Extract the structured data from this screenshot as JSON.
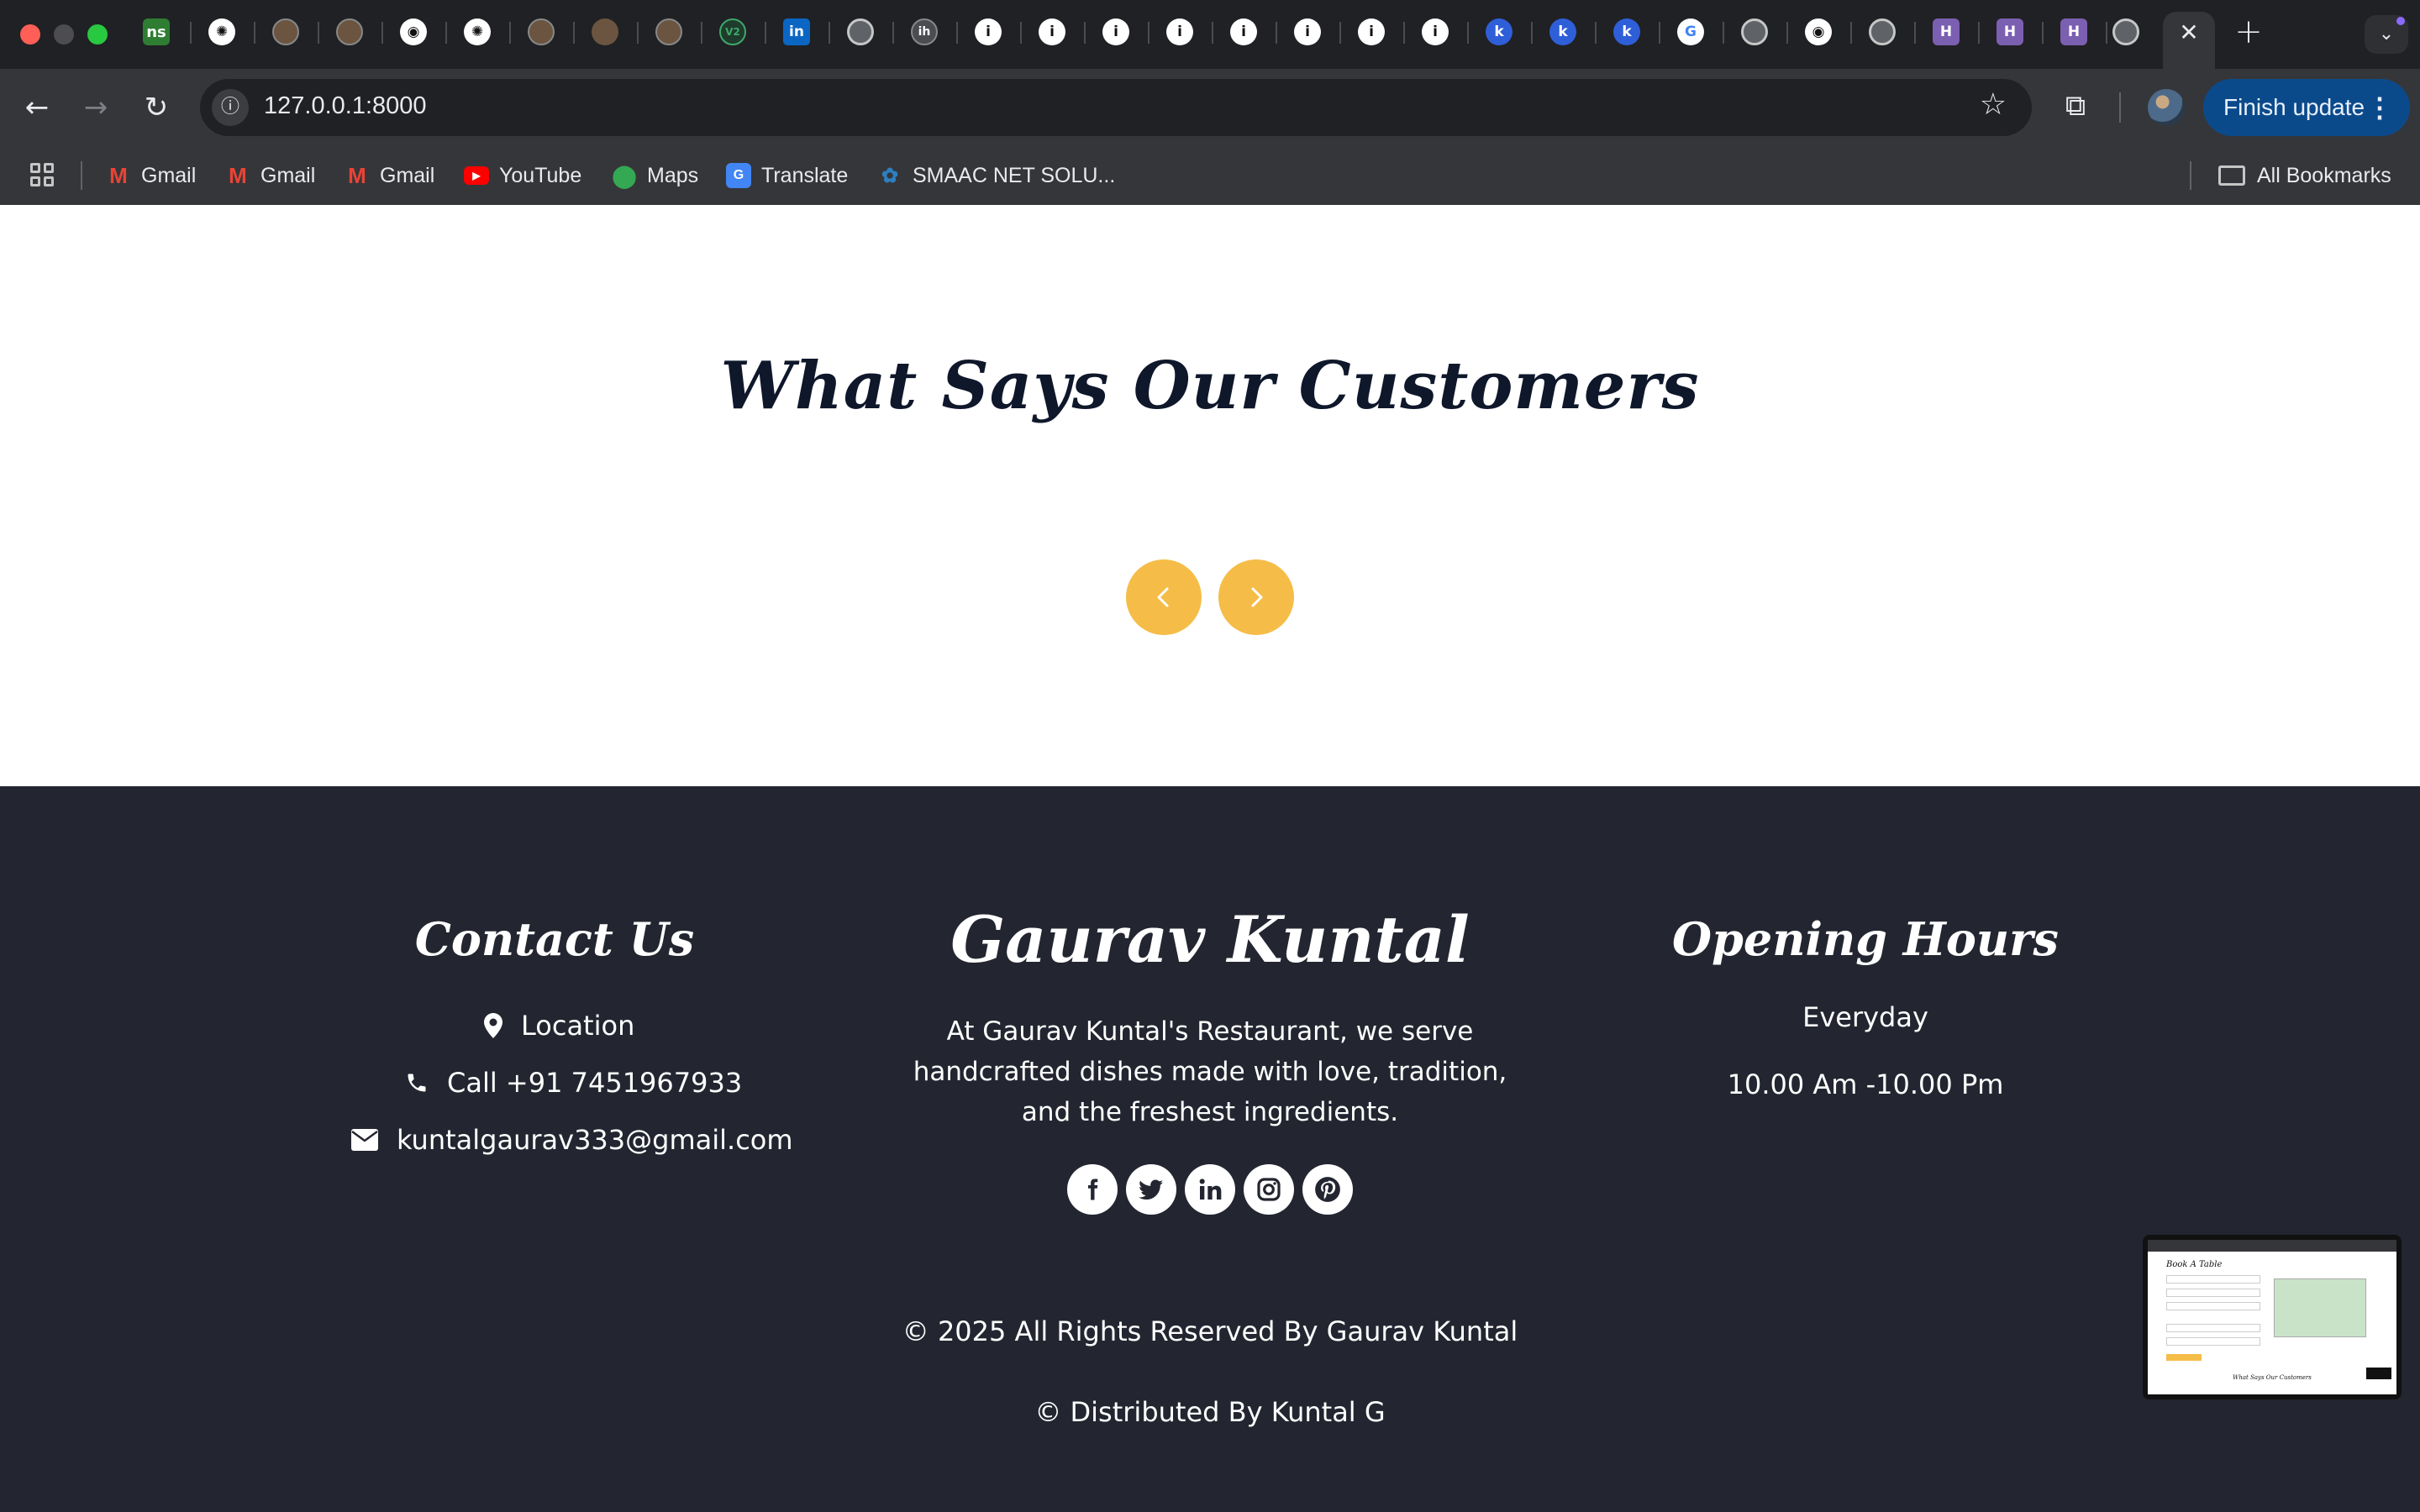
{
  "browser": {
    "url": "127.0.0.1:8000",
    "update_button": "Finish update",
    "bookmarks": [
      {
        "label": "Gmail",
        "icon": "gmail-icon",
        "color": "#ea4335"
      },
      {
        "label": "Gmail",
        "icon": "gmail-icon",
        "color": "#ea4335"
      },
      {
        "label": "Gmail",
        "icon": "gmail-icon",
        "color": "#ea4335"
      },
      {
        "label": "YouTube",
        "icon": "youtube-icon",
        "color": "#ff0000"
      },
      {
        "label": "Maps",
        "icon": "maps-icon",
        "color": "#34a853"
      },
      {
        "label": "Translate",
        "icon": "translate-icon",
        "color": "#4285f4"
      },
      {
        "label": "SMAAC NET SOLU...",
        "icon": "smaac-icon",
        "color": "#2d7fc1"
      }
    ],
    "all_bookmarks": "All Bookmarks"
  },
  "testimonials": {
    "title": "What Says Our Customers",
    "prev_icon": "chevron-left-icon",
    "next_icon": "chevron-right-icon",
    "accent_color": "#f5bd48"
  },
  "footer": {
    "contact": {
      "title": "Contact Us",
      "location": "Location",
      "phone": "Call +91 7451967933",
      "email": "kuntalgaurav333@gmail.com"
    },
    "brand": {
      "title": "Gaurav Kuntal",
      "description": "At Gaurav Kuntal's Restaurant, we serve handcrafted dishes made with love, tradition, and the freshest ingredients.",
      "social": [
        "facebook-icon",
        "twitter-icon",
        "linkedin-icon",
        "instagram-icon",
        "pinterest-icon"
      ]
    },
    "hours": {
      "title": "Opening Hours",
      "days": "Everyday",
      "time": "10.00 Am -10.00 Pm"
    },
    "copyright": "© 2025 All Rights Reserved By Gaurav Kuntal",
    "distributed": "© Distributed By Kuntal G",
    "background": "#232630"
  },
  "preview_thumbnail": {
    "heading": "Book A Table",
    "subheading": "What Says Our Customers"
  }
}
